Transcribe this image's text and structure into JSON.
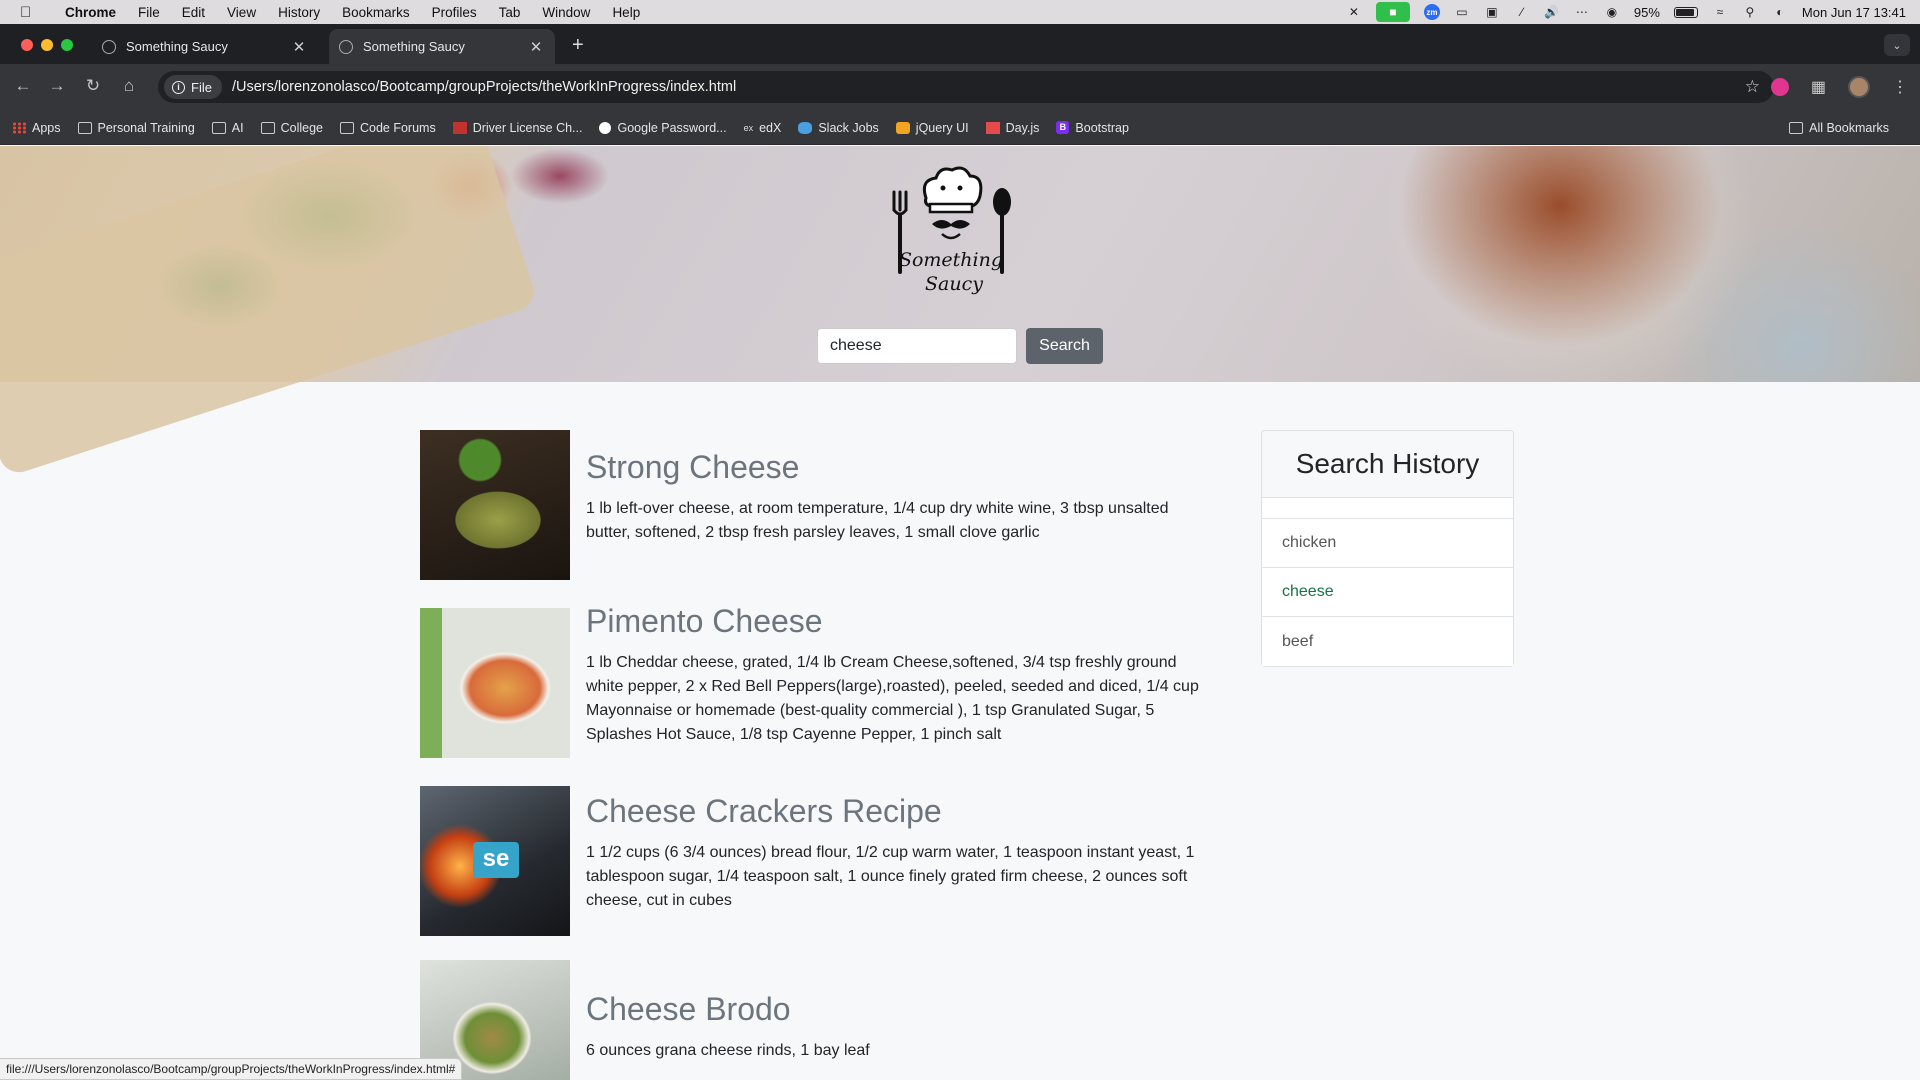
{
  "menubar": {
    "app": "Chrome",
    "items": [
      "File",
      "Edit",
      "View",
      "History",
      "Bookmarks",
      "Profiles",
      "Tab",
      "Window",
      "Help"
    ],
    "battery": "95%",
    "datetime": "Mon Jun 17  13:41"
  },
  "tabs": [
    {
      "title": "Something Saucy"
    },
    {
      "title": "Something Saucy"
    }
  ],
  "toolbar": {
    "chip": "File",
    "url": "/Users/lorenzonolasco/Bootcamp/groupProjects/theWorkInProgress/index.html"
  },
  "bookmarks": [
    {
      "label": "Apps",
      "icon": "apps-grid-icon"
    },
    {
      "label": "Personal Training",
      "icon": "folder-icon"
    },
    {
      "label": "AI",
      "icon": "folder-icon"
    },
    {
      "label": "College",
      "icon": "folder-icon"
    },
    {
      "label": "Code Forums",
      "icon": "folder-icon"
    },
    {
      "label": "Driver License Ch...",
      "icon": "dlc-icon"
    },
    {
      "label": "Google Password...",
      "icon": "google-icon"
    },
    {
      "label": "edX",
      "icon": "edx-icon"
    },
    {
      "label": "Slack Jobs",
      "icon": "slack-icon"
    },
    {
      "label": "jQuery UI",
      "icon": "jquery-icon"
    },
    {
      "label": "Day.js",
      "icon": "dayjs-icon"
    },
    {
      "label": "Bootstrap",
      "icon": "bootstrap-icon"
    }
  ],
  "all_bookmarks": "All Bookmarks",
  "hero": {
    "logo_text_1": "Something",
    "logo_text_2": "Saucy",
    "search_value": "cheese",
    "search_button": "Search"
  },
  "recipes": [
    {
      "title": "Strong Cheese",
      "ingredients": "1 lb left-over cheese, at room temperature, 1/4 cup dry white wine, 3 tbsp unsalted butter, softened, 2 tbsp fresh parsley leaves, 1 small clove garlic"
    },
    {
      "title": "Pimento Cheese",
      "ingredients": "1 lb Cheddar cheese, grated, 1/4 lb Cream Cheese,softened, 3/4 tsp freshly ground white pepper, 2 x Red Bell Peppers(large),roasted), peeled, seeded and diced, 1/4 cup Mayonnaise or homemade (best-quality commercial ), 1 tsp Granulated Sugar, 5 Splashes Hot Sauce, 1/8 tsp Cayenne Pepper, 1 pinch salt"
    },
    {
      "title": "Cheese Crackers Recipe",
      "ingredients": "1 1/2 cups (6 3/4 ounces) bread flour, 1/2 cup warm water, 1 teaspoon instant yeast, 1 tablespoon sugar, 1/4 teaspoon salt, 1 ounce finely grated firm cheese, 2 ounces soft cheese, cut in cubes",
      "badge": "se"
    },
    {
      "title": "Cheese Brodo",
      "ingredients": "6 ounces grana cheese rinds, 1 bay leaf"
    }
  ],
  "history": {
    "title": "Search History",
    "items": [
      "chicken",
      "cheese",
      "beef"
    ],
    "active": "cheese"
  },
  "statusbar": "file:///Users/lorenzonolasco/Bootcamp/groupProjects/theWorkInProgress/index.html#"
}
